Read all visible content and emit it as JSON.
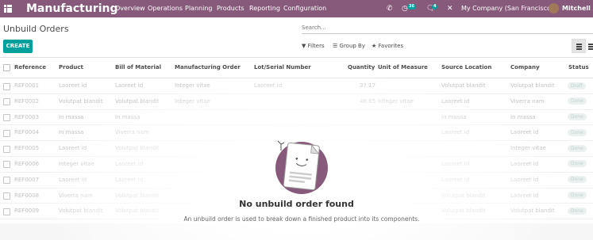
{
  "navbar": {
    "app_title": "Manufacturing",
    "menu": [
      "Overview",
      "Operations",
      "Planning",
      "Products",
      "Reporting",
      "Configuration"
    ],
    "activity_count": "36",
    "messages_count": "4",
    "company": "My Company (San Francisco)",
    "user": "Mitchell Admin"
  },
  "control": {
    "page_title": "Unbuild Orders",
    "search_placeholder": "Search...",
    "create_label": "CREATE",
    "filters_label": "Filters",
    "group_by_label": "Group By",
    "favorites_label": "Favorites"
  },
  "table": {
    "headers": [
      "Reference",
      "Product",
      "Bill of Material",
      "Manufacturing Order",
      "Lot/Serial Number",
      "Quantity",
      "Unit of Measure",
      "Source Location",
      "Company",
      "Status"
    ],
    "rows": [
      {
        "ref": "REF0001",
        "product": "Laoreet id",
        "bom": "Laoreet id",
        "mo": "Integer vitae",
        "lot": "Laoreet id",
        "qty": "37.17",
        "uom": "",
        "src": "Volutpat blandit",
        "company": "Volutpat blandit",
        "status": "Draft"
      },
      {
        "ref": "REF0002",
        "product": "Volutpat blandit",
        "bom": "Volutpat blandit",
        "mo": "Integer vitae",
        "lot": "",
        "qty": "46.65",
        "uom": "Integer vitae",
        "src": "Laoreet id",
        "company": "Viverra nam",
        "status": "Done"
      },
      {
        "ref": "REF0003",
        "product": "In massa",
        "bom": "In massa",
        "mo": "",
        "lot": "",
        "qty": "",
        "uom": "",
        "src": "In massa",
        "company": "In massa",
        "status": "Done"
      },
      {
        "ref": "REF0004",
        "product": "In massa",
        "bom": "Viverra nam",
        "mo": "",
        "lot": "",
        "qty": "",
        "uom": "",
        "src": "Laoreet id",
        "company": "Laoreet id",
        "status": "Done"
      },
      {
        "ref": "REF0005",
        "product": "Laoreet id",
        "bom": "Volutpat blandit",
        "mo": "",
        "lot": "",
        "qty": "",
        "uom": "",
        "src": "",
        "company": "Integer vitae",
        "status": "Done"
      },
      {
        "ref": "REF0006",
        "product": "Integer vitae",
        "bom": "Laoreet id",
        "mo": "",
        "lot": "",
        "qty": "",
        "uom": "",
        "src": "Laoreet id",
        "company": "Laoreet id",
        "status": "Done"
      },
      {
        "ref": "REF0007",
        "product": "Laoreet id",
        "bom": "Laoreet id",
        "mo": "",
        "lot": "",
        "qty": "",
        "uom": "",
        "src": "Laoreet id",
        "company": "Laoreet id",
        "status": "Done"
      },
      {
        "ref": "REF0008",
        "product": "Viverra nam",
        "bom": "Volutpat blandit",
        "mo": "",
        "lot": "",
        "qty": "",
        "uom": "",
        "src": "Volutpat blandit",
        "company": "Laoreet id",
        "status": "Done"
      },
      {
        "ref": "REF0009",
        "product": "Volutpat blandit",
        "bom": "Volutpat blandit",
        "mo": "",
        "lot": "",
        "qty": "",
        "uom": "",
        "src": "Volutpat blandit",
        "company": "Volutpat blandit",
        "status": "Done"
      },
      {
        "ref": "REF0010",
        "product": "In massa",
        "bom": "Viverra nam",
        "mo": "",
        "lot": "",
        "qty": "",
        "uom": "",
        "src": "In massa",
        "company": "Laoreet id",
        "status": "Done"
      }
    ]
  },
  "empty_state": {
    "title": "No unbuild order found",
    "description": "An unbuild order is used to break down a finished product into its components."
  },
  "colors": {
    "navbar": "#875a7b",
    "primary": "#00a09d",
    "illustration": "#875a7b"
  }
}
